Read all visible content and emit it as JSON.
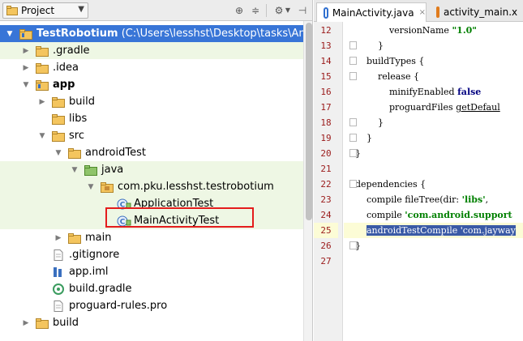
{
  "project_panel": {
    "view_select": "Project",
    "icons": [
      "globe-icon",
      "collapse-all-icon",
      "settings-icon",
      "hide-panel-icon"
    ]
  },
  "tree": [
    {
      "name": "tree-item-testrobotium",
      "label": "TestRobotium",
      "path": " (C:\\Users\\lesshst\\Desktop\\tasks\\AndroidV",
      "indent": 0,
      "expanded": true,
      "icon": "module-folder",
      "selected": true,
      "bold": true
    },
    {
      "name": "tree-item-gradle-dir",
      "label": ".gradle",
      "indent": 1,
      "expanded": false,
      "icon": "folder",
      "green": true
    },
    {
      "name": "tree-item-idea",
      "label": ".idea",
      "indent": 1,
      "expanded": false,
      "icon": "folder"
    },
    {
      "name": "tree-item-app",
      "label": "app",
      "indent": 1,
      "expanded": true,
      "icon": "module-folder",
      "bold": true
    },
    {
      "name": "tree-item-build-app",
      "label": "build",
      "indent": 2,
      "expanded": false,
      "icon": "folder"
    },
    {
      "name": "tree-item-libs",
      "label": "libs",
      "indent": 2,
      "leaf": true,
      "icon": "folder"
    },
    {
      "name": "tree-item-src",
      "label": "src",
      "indent": 2,
      "expanded": true,
      "icon": "folder"
    },
    {
      "name": "tree-item-androidtest",
      "label": "androidTest",
      "indent": 3,
      "expanded": true,
      "icon": "folder"
    },
    {
      "name": "tree-item-java",
      "label": "java",
      "indent": 4,
      "expanded": true,
      "icon": "test-folder",
      "green": true
    },
    {
      "name": "tree-item-package",
      "label": "com.pku.lesshst.testrobotium",
      "indent": 5,
      "expanded": true,
      "icon": "package",
      "green": true
    },
    {
      "name": "tree-item-applicationtest",
      "label": "ApplicationTest",
      "indent": 6,
      "leaf": true,
      "icon": "class",
      "green": true
    },
    {
      "name": "tree-item-mainactivitytest",
      "label": "MainActivityTest",
      "indent": 6,
      "leaf": true,
      "icon": "class",
      "green": true
    },
    {
      "name": "tree-item-main",
      "label": "main",
      "indent": 3,
      "expanded": false,
      "icon": "folder"
    },
    {
      "name": "tree-item-gitignore",
      "label": ".gitignore",
      "indent": 2,
      "leaf": true,
      "icon": "file"
    },
    {
      "name": "tree-item-app-iml",
      "label": "app.iml",
      "indent": 2,
      "leaf": true,
      "icon": "iml"
    },
    {
      "name": "tree-item-build-gradle",
      "label": "build.gradle",
      "indent": 2,
      "leaf": true,
      "icon": "gradle"
    },
    {
      "name": "tree-item-proguard",
      "label": "proguard-rules.pro",
      "indent": 2,
      "leaf": true,
      "icon": "file"
    },
    {
      "name": "tree-item-build-root",
      "label": "build",
      "indent": 1,
      "expanded": false,
      "icon": "folder"
    }
  ],
  "editor": {
    "tabs": [
      {
        "name": "tab-mainactivity-java",
        "label": "MainActivity.java",
        "icon_color": "#2f6fcf",
        "active": true
      },
      {
        "name": "tab-activity-main-xml",
        "label": "activity_main.x",
        "icon_color": "#e07b1c",
        "active": false
      }
    ],
    "lines": [
      {
        "num": "12",
        "fold": false,
        "parts": [
          [
            "t",
            "            versionName "
          ],
          [
            "str",
            "\"1.0\""
          ]
        ]
      },
      {
        "num": "13",
        "fold": true,
        "parts": [
          [
            "t",
            "        }"
          ]
        ]
      },
      {
        "num": "14",
        "fold": true,
        "parts": [
          [
            "t",
            "    buildTypes {"
          ]
        ]
      },
      {
        "num": "15",
        "fold": true,
        "parts": [
          [
            "t",
            "        release {"
          ]
        ]
      },
      {
        "num": "16",
        "fold": false,
        "parts": [
          [
            "t",
            "            minifyEnabled "
          ],
          [
            "kw",
            "false"
          ]
        ]
      },
      {
        "num": "17",
        "fold": false,
        "parts": [
          [
            "t",
            "            proguardFiles "
          ],
          [
            "ul",
            "getDefaul"
          ]
        ]
      },
      {
        "num": "18",
        "fold": true,
        "parts": [
          [
            "t",
            "        }"
          ]
        ]
      },
      {
        "num": "19",
        "fold": true,
        "parts": [
          [
            "t",
            "    }"
          ]
        ]
      },
      {
        "num": "20",
        "fold": true,
        "parts": [
          [
            "t",
            "}"
          ]
        ]
      },
      {
        "num": "21",
        "fold": false,
        "parts": [
          [
            "t",
            ""
          ]
        ]
      },
      {
        "num": "22",
        "fold": true,
        "parts": [
          [
            "t",
            "dependencies {"
          ]
        ]
      },
      {
        "num": "23",
        "fold": false,
        "parts": [
          [
            "t",
            "    compile fileTree(dir: "
          ],
          [
            "str",
            "'libs'"
          ],
          [
            "t",
            ","
          ]
        ]
      },
      {
        "num": "24",
        "fold": false,
        "parts": [
          [
            "t",
            "    compile "
          ],
          [
            "str",
            "'com.android.support"
          ]
        ]
      },
      {
        "num": "25",
        "fold": false,
        "current": true,
        "parts": [
          [
            "t",
            "    "
          ],
          [
            "sel",
            "androidTestCompile 'com.jayway"
          ]
        ]
      },
      {
        "num": "26",
        "fold": true,
        "parts": [
          [
            "t",
            "}"
          ]
        ]
      },
      {
        "num": "27",
        "fold": false,
        "parts": [
          [
            "t",
            ""
          ]
        ]
      }
    ]
  }
}
